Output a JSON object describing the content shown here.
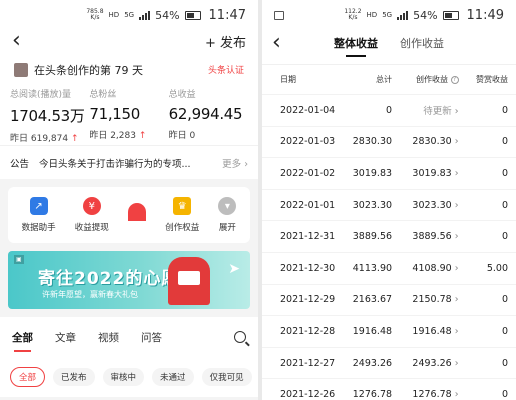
{
  "left": {
    "status": {
      "speed_top": "785.8",
      "speed_unit": "K/s",
      "network": "HD",
      "signal": "5G",
      "battery": "54%",
      "time": "11:47"
    },
    "nav": {
      "back_glyph": "‹",
      "publish_label": "+ 发布"
    },
    "header": {
      "title": "在头条创作的第 79 天",
      "certify": "头条认证"
    },
    "stats": [
      {
        "label": "总阅读(播放)量",
        "value": "1704.53万",
        "yesterday": "昨日 619,874",
        "trend": "↑"
      },
      {
        "label": "总粉丝",
        "value": "71,150",
        "yesterday": "昨日 2,283",
        "trend": "↑"
      },
      {
        "label": "总收益",
        "value": "62,994.45",
        "yesterday": "昨日 0",
        "trend": ""
      }
    ],
    "notice": {
      "tag": "公告",
      "text": "今日头条关于打击诈骗行为的专项...",
      "more": "更多 ›"
    },
    "tools": [
      {
        "label": "数据助手",
        "color": "#2f7ae5",
        "glyph": "↗"
      },
      {
        "label": "收益提现",
        "color": "#f04142",
        "glyph": "¥"
      },
      {
        "label": "",
        "color": "#f04142",
        "glyph": ""
      },
      {
        "label": "创作权益",
        "color": "#f5b400",
        "glyph": "♛"
      },
      {
        "label": "展开",
        "color": "#bdbdbd",
        "glyph": "▾"
      }
    ],
    "banner": {
      "title": "寄往2022的心愿",
      "subtitle": "许新年愿望，赢新春大礼包"
    },
    "tabs": [
      "全部",
      "文章",
      "视频",
      "问答"
    ],
    "filters": [
      "全部",
      "已发布",
      "审核中",
      "未通过",
      "仅我可见"
    ]
  },
  "right": {
    "status": {
      "speed_top": "112.2",
      "speed_unit": "K/s",
      "network": "HD",
      "signal": "5G",
      "battery": "54%",
      "time": "11:49"
    },
    "tabs": [
      "整体收益",
      "创作收益"
    ],
    "table": {
      "headers": [
        "日期",
        "总计",
        "创作收益",
        "赞赏收益"
      ],
      "rows": [
        {
          "date": "2022-01-04",
          "total": "0",
          "create": "待更新",
          "reward": "0"
        },
        {
          "date": "2022-01-03",
          "total": "2830.30",
          "create": "2830.30",
          "reward": "0"
        },
        {
          "date": "2022-01-02",
          "total": "3019.83",
          "create": "3019.83",
          "reward": "0"
        },
        {
          "date": "2022-01-01",
          "total": "3023.30",
          "create": "3023.30",
          "reward": "0"
        },
        {
          "date": "2021-12-31",
          "total": "3889.56",
          "create": "3889.56",
          "reward": "0"
        },
        {
          "date": "2021-12-30",
          "total": "4113.90",
          "create": "4108.90",
          "reward": "5.00"
        },
        {
          "date": "2021-12-29",
          "total": "2163.67",
          "create": "2150.78",
          "reward": "0"
        },
        {
          "date": "2021-12-28",
          "total": "1916.48",
          "create": "1916.48",
          "reward": "0"
        },
        {
          "date": "2021-12-27",
          "total": "2493.26",
          "create": "2493.26",
          "reward": "0"
        },
        {
          "date": "2021-12-26",
          "total": "1276.78",
          "create": "1276.78",
          "reward": "0"
        }
      ]
    }
  }
}
